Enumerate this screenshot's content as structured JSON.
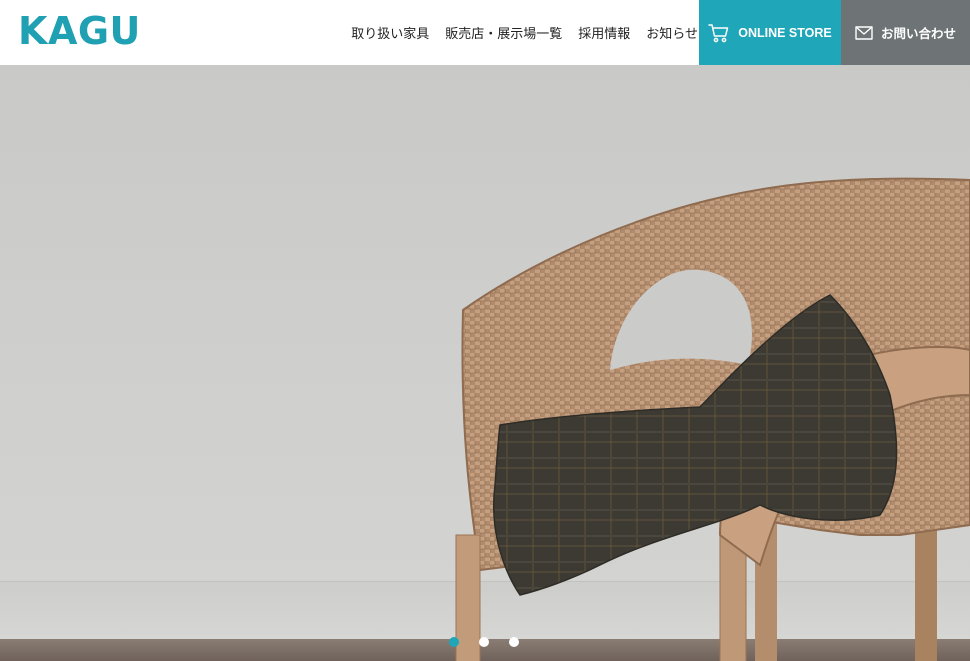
{
  "header": {
    "logo": "KAGU",
    "nav": [
      {
        "label": "取り扱い家具"
      },
      {
        "label": "販売店・展示場一覧"
      },
      {
        "label": "採用情報"
      },
      {
        "label": "お知らせ"
      }
    ],
    "online_store": {
      "label": "ONLINE STORE",
      "icon": "cart-icon"
    },
    "contact": {
      "label": "お問い合わせ",
      "icon": "mail-icon"
    }
  },
  "hero": {
    "image": "wicker-chair-with-blanket",
    "slider": {
      "count": 3,
      "active": 1
    }
  },
  "colors": {
    "accent": "#1fa6b8",
    "contact_bg": "#6e7375",
    "logo": "#1fa0b3"
  }
}
